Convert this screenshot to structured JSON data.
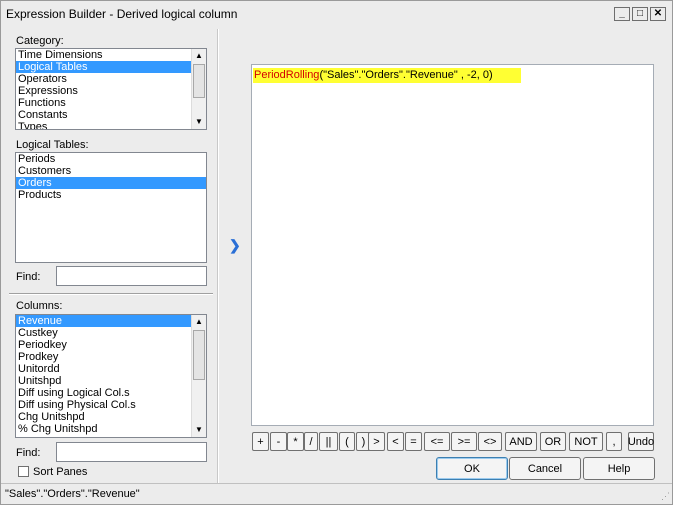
{
  "window": {
    "title": "Expression Builder - Derived logical column"
  },
  "title_buttons": {
    "minimize": "_",
    "maximize": "□",
    "close": "✕"
  },
  "category": {
    "label": "Category:",
    "items": [
      "Time Dimensions",
      "Logical Tables",
      "Operators",
      "Expressions",
      "Functions",
      "Constants",
      "Types"
    ],
    "selected": 1
  },
  "logical_tables": {
    "label": "Logical Tables:",
    "items": [
      "Periods",
      "Customers",
      "Orders",
      "Products"
    ],
    "selected": 2
  },
  "find_tables": {
    "label": "Find:",
    "value": ""
  },
  "columns": {
    "label": "Columns:",
    "items": [
      "Revenue",
      "Custkey",
      "Periodkey",
      "Prodkey",
      "Unitordd",
      "Unitshpd",
      "Diff using Logical Col.s",
      "Diff using Physical Col.s",
      "Chg Unitshpd",
      "% Chg Unitshpd"
    ],
    "selected": 0
  },
  "find_columns": {
    "label": "Find:",
    "value": ""
  },
  "sort_panes": {
    "label": "Sort Panes",
    "checked": false
  },
  "insert_icon": "chevron-right",
  "expression": {
    "function": "PeriodRolling",
    "args": "(\"Sales\".\"Orders\".\"Revenue\" , -2, 0)",
    "highlight_color": "#ffff33",
    "function_color": "#d40000"
  },
  "operators": [
    "+",
    "-",
    "*",
    "/",
    "||",
    "(",
    ")",
    ">",
    "<",
    "=",
    "<=",
    ">=",
    "<>",
    "AND",
    "OR",
    "NOT",
    ",",
    "Undo"
  ],
  "buttons": {
    "ok": "OK",
    "cancel": "Cancel",
    "help": "Help"
  },
  "status": {
    "text": "\"Sales\".\"Orders\".\"Revenue\""
  },
  "colors": {
    "selection": "#3399ff",
    "chevron": "#2a6fd6"
  }
}
